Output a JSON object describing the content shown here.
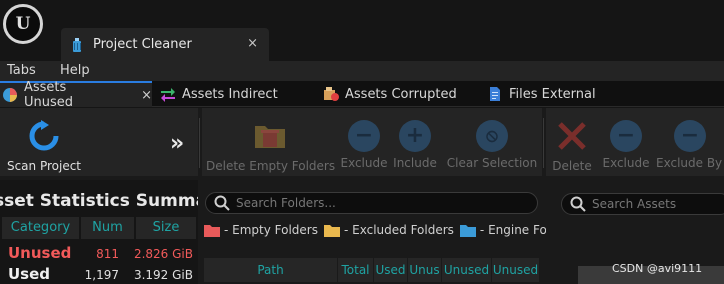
{
  "window": {
    "logo_text": "U",
    "document_tab": {
      "label": "Project Cleaner",
      "close": "×"
    }
  },
  "menu": [
    "Tabs",
    "Help"
  ],
  "tabs": [
    {
      "label": "Assets Unused",
      "close": "×",
      "icon": "pie-icon"
    },
    {
      "label": "Assets Indirect",
      "icon": "indirect-icon"
    },
    {
      "label": "Assets Corrupted",
      "icon": "corrupted-icon"
    },
    {
      "label": "Files External",
      "icon": "file-icon"
    }
  ],
  "toolbar_left": {
    "scan_label": "Scan Project",
    "more": "»"
  },
  "toolbar_folders": {
    "delete_empty": "Delete Empty Folders",
    "exclude": "Exclude",
    "include": "Include",
    "clear_selection": "Clear Selection"
  },
  "toolbar_assets": {
    "delete": "Delete",
    "exclude": "Exclude",
    "exclude_by": "Exclude By C"
  },
  "stats": {
    "title": "sset Statistics Summa",
    "headers": [
      "Category",
      "Num",
      "Size"
    ],
    "rows": [
      {
        "category": "Unused",
        "num": "811",
        "size": "2.826 GiB",
        "color": "#f25a5a"
      },
      {
        "category": "Used",
        "num": "1,197",
        "size": "3.192 GiB",
        "color": "#f0f0f0"
      }
    ]
  },
  "folders": {
    "search_placeholder": "Search Folders...",
    "legend": [
      "- Empty Folders",
      "- Excluded Folders",
      "- Engine Folders"
    ],
    "legend_colors": [
      "#e85a5a",
      "#e9b84e",
      "#3b9bd8"
    ],
    "columns": [
      "Path",
      "Total",
      "Used",
      "Unus",
      "Unused",
      "Unused"
    ]
  },
  "assets": {
    "search_placeholder": "Search Assets"
  },
  "watermark": "CSDN @avi9111",
  "colors": {
    "accent": "#2a7de1",
    "teal_header": "#1fa3a3",
    "blue_button": "#1f6fb4"
  }
}
